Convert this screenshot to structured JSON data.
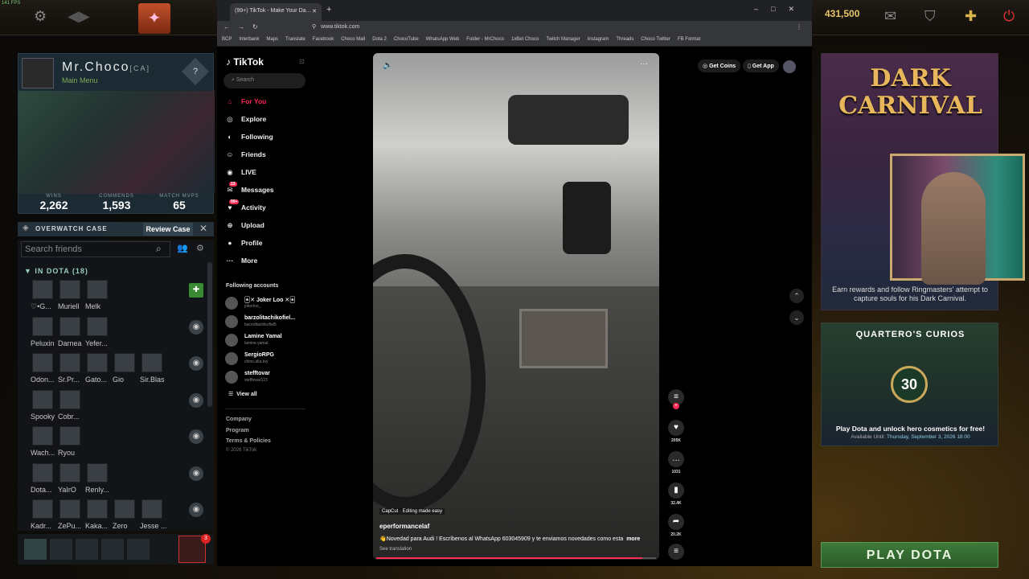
{
  "fps": "141 FPS",
  "gold": "431,500",
  "profile": {
    "name": "Mr.Choco",
    "tag": "[CA]",
    "menu": "Main Menu",
    "stats": [
      {
        "label": "WINS",
        "value": "2,262"
      },
      {
        "label": "COMMENDS",
        "value": "1,593"
      },
      {
        "label": "MATCH MVPS",
        "value": "65"
      }
    ]
  },
  "overwatch": {
    "label": "OVERWATCH CASE",
    "button": "Review Case"
  },
  "friends": {
    "search_placeholder": "Search friends",
    "section": "IN DOTA (18)",
    "rows": [
      [
        "♡•G...",
        "Muriell",
        "Melk"
      ],
      [
        "Peluxin",
        "Darnea",
        "Yefer..."
      ],
      [
        "Odon...",
        "Sr.Pr...",
        "Gato...",
        "Gio",
        "Sir.Blas"
      ],
      [
        "Spooky",
        "Cobr..."
      ],
      [
        "Wach...",
        "Ryou"
      ],
      [
        "Dota...",
        "YaIrO",
        "Renly..."
      ],
      [
        "Kadr...",
        "ZePu...",
        "Kaka...",
        "Zero",
        "Jesse ..."
      ]
    ],
    "party_badge": "3"
  },
  "browser": {
    "tab_title": "(99+) TikTok - Make Your Da...",
    "url": "www.tiktok.com",
    "bookmarks": [
      "BCP",
      "Interbank",
      "Maps",
      "Translate",
      "Facebook",
      "Choco Mail",
      "Dota 2",
      "ChocoTube",
      "WhatsApp Web",
      "Folder - MrChoco",
      "1xBet Choco",
      "Twitch Manager",
      "Instagram",
      "Threads",
      "Choco Twitter",
      "FB Format"
    ]
  },
  "tiktok": {
    "logo": "TikTok",
    "search": "Search",
    "nav": [
      {
        "icon": "⌂",
        "label": "For You",
        "active": true
      },
      {
        "icon": "◎",
        "label": "Explore"
      },
      {
        "icon": "◐",
        "label": "Following"
      },
      {
        "icon": "☺",
        "label": "Friends"
      },
      {
        "icon": "◉",
        "label": "LIVE"
      },
      {
        "icon": "✉",
        "label": "Messages",
        "badge": "23"
      },
      {
        "icon": "♥",
        "label": "Activity",
        "badge": "99+"
      },
      {
        "icon": "⊕",
        "label": "Upload"
      },
      {
        "icon": "●",
        "label": "Profile"
      },
      {
        "icon": "···",
        "label": "More"
      }
    ],
    "following_header": "Following accounts",
    "accounts": [
      {
        "name": "🃏✕ Joker Loo ✕🃏",
        "handle": "jokerloo_"
      },
      {
        "name": "barzolitachikofiel...",
        "handle": "barzolitachikofiel5"
      },
      {
        "name": "Lamine Yamal",
        "handle": "lamine.yamal"
      },
      {
        "name": "SergioRPG",
        "handle": "chino.aka.toy"
      },
      {
        "name": "stefftovar",
        "handle": "stefftovar123"
      }
    ],
    "view_all": "View all",
    "footer": [
      "Company",
      "Program",
      "Terms & Policies",
      "© 2026 TikTok"
    ],
    "get_coins": "Get Coins",
    "get_app": "Get App",
    "video": {
      "capcut": "CapCut · Editing made easy",
      "author": "eperformancelaf",
      "description": "👋Novedad para Audi ! Escríbenos al WhatsApp 603045909 y te enviamos novedades como esta",
      "more": "more",
      "see_translation": "See translation",
      "progress": 0.95
    },
    "actions": [
      {
        "icon": "♥",
        "count": "205K"
      },
      {
        "icon": "…",
        "count": "1031"
      },
      {
        "icon": "▮",
        "count": "32.4K"
      },
      {
        "icon": "➦",
        "count": "20.2K"
      }
    ]
  },
  "carnival": {
    "title_line1": "DARK",
    "title_line2": "CARNIVAL",
    "description": "Earn rewards and follow Ringmasters' attempt to capture souls for his Dark Carnival."
  },
  "curios": {
    "title": "QUARTERO'S CURIOS",
    "badge": "30",
    "desc": "Play Dota and unlock hero cosmetics for free!",
    "avail_label": "Available Until:",
    "avail_date": "Thursday, September 3, 2026 18:00"
  },
  "play_button": "PLAY DOTA"
}
